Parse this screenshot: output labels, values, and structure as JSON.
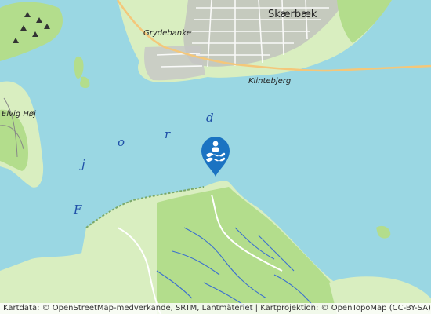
{
  "map": {
    "place_labels": {
      "skaerbaek": "Skærbæk",
      "grydebanke": "Grydebanke",
      "klintebjerg": "Klintebjerg",
      "elvig_hoj": "Elvig Høj"
    },
    "water_letters": [
      "F",
      "j",
      "o",
      "r",
      "d"
    ],
    "marker": {
      "icon": "swimming-icon",
      "color": "#1a73c2"
    },
    "colors": {
      "water": "#9ad7e3",
      "forest": "#b3dd8c",
      "meadow": "#d9eec0",
      "urban": "#b8b8b8",
      "shore": "#b8d9a8"
    }
  },
  "attribution": {
    "text": "Kartdata: © OpenStreetMap-medverkande, SRTM, Lantmäteriet | Kartprojektion: © OpenTopoMap (CC-BY-SA)"
  }
}
